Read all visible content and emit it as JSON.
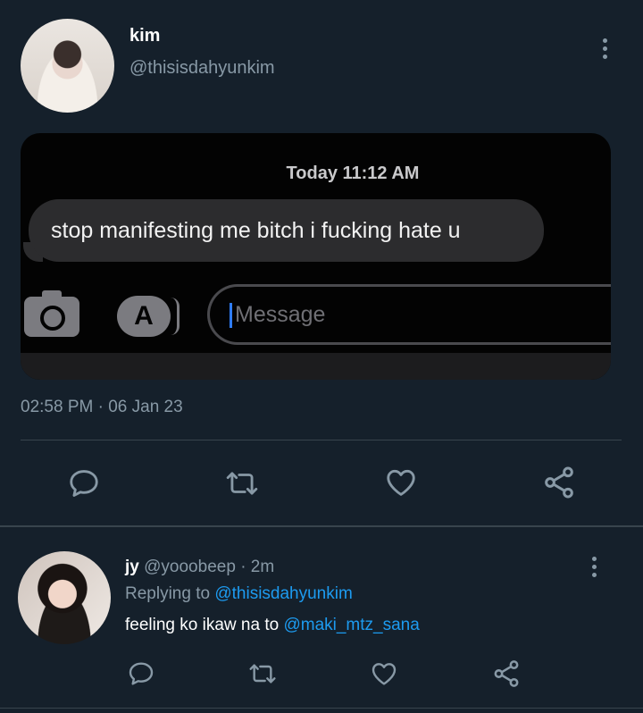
{
  "tweet": {
    "author_name": "kim",
    "author_handle": "@thisisdahyunkim",
    "timestamp": "02:58 PM · 06 Jan 23",
    "media": {
      "time_label": "Today 11:12 AM",
      "message_text": "stop manifesting me bitch i fucking hate u",
      "input_placeholder": "Message",
      "appstore_glyph": "A"
    },
    "icons": [
      "reply-icon",
      "retweet-icon",
      "like-icon",
      "share-icon",
      "more-icon"
    ]
  },
  "reply": {
    "author_name": "jy",
    "author_handle": "@yooobeep",
    "age": "· 2m",
    "replying_prefix": "Replying to",
    "replying_to": "@thisisdahyunkim",
    "text": "feeling ko ikaw na to",
    "mention": "@maki_mtz_sana"
  },
  "colors": {
    "background": "#15202b",
    "link": "#1d9bf0",
    "secondary_text": "#8899a6"
  }
}
